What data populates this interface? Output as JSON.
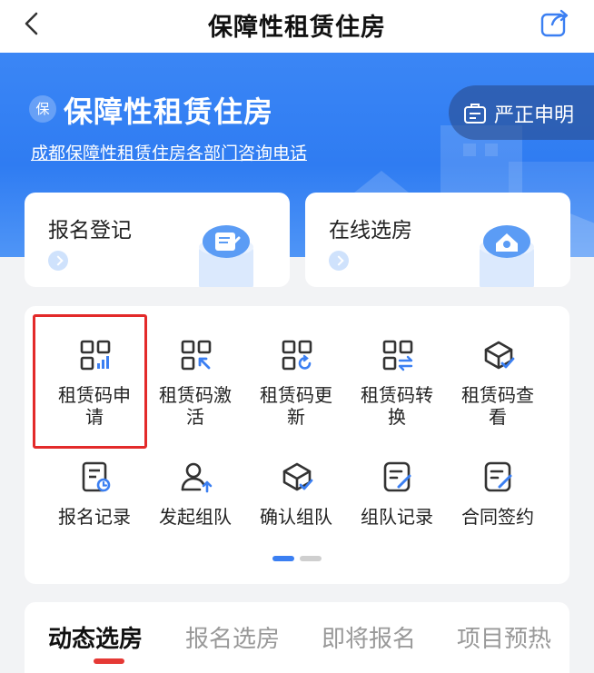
{
  "navbar": {
    "title": "保障性租赁住房",
    "back_icon": "chevron-left-icon",
    "share_icon": "share-icon"
  },
  "banner": {
    "logo_text": "保",
    "title": "保障性租赁住房",
    "link": "成都保障性租赁住房各部门咨询电话",
    "declare_button": "严正申明",
    "colors": {
      "primary": "#2f7cf2",
      "accent": "#e53935"
    }
  },
  "actions": [
    {
      "label": "报名登记",
      "icon": "registration-doc-icon"
    },
    {
      "label": "在线选房",
      "icon": "house-select-icon"
    }
  ],
  "grid": {
    "highlighted_item": "租赁码申请",
    "items": [
      {
        "label": "租赁码申请",
        "icon": "qr-code-chart-icon"
      },
      {
        "label": "租赁码激活",
        "icon": "qr-code-activate-icon"
      },
      {
        "label": "租赁码更新",
        "icon": "qr-code-refresh-icon"
      },
      {
        "label": "租赁码转换",
        "icon": "qr-code-transfer-icon"
      },
      {
        "label": "租赁码查看",
        "icon": "view-box-icon"
      },
      {
        "label": "报名记录",
        "icon": "record-list-icon"
      },
      {
        "label": "发起组队",
        "icon": "team-up-icon"
      },
      {
        "label": "确认组队",
        "icon": "confirm-team-icon"
      },
      {
        "label": "组队记录",
        "icon": "team-record-icon"
      },
      {
        "label": "合同签约",
        "icon": "contract-sign-icon"
      }
    ],
    "page_indicator": {
      "pages": 2,
      "current": 1
    }
  },
  "tabs": [
    {
      "label": "动态选房",
      "active": true
    },
    {
      "label": "报名选房",
      "active": false
    },
    {
      "label": "即将报名",
      "active": false
    },
    {
      "label": "项目预热",
      "active": false
    }
  ]
}
